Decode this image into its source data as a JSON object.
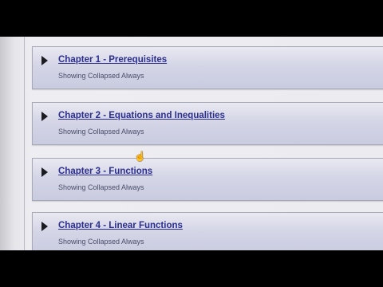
{
  "chapters": [
    {
      "title": "Chapter 1 - Prerequisites",
      "subtitle": "Showing Collapsed Always"
    },
    {
      "title": "Chapter 2 - Equations and Inequalities",
      "subtitle": "Showing Collapsed Always"
    },
    {
      "title": "Chapter 3 - Functions",
      "subtitle": "Showing Collapsed Always"
    },
    {
      "title": "Chapter 4 - Linear Functions",
      "subtitle": "Showing Collapsed Always"
    }
  ],
  "icons": {
    "toggle": "caret-right-icon",
    "cursor": "hand-pointer-icon"
  },
  "colors": {
    "link": "#2b2e8f",
    "panel": "#d4d5e6"
  }
}
